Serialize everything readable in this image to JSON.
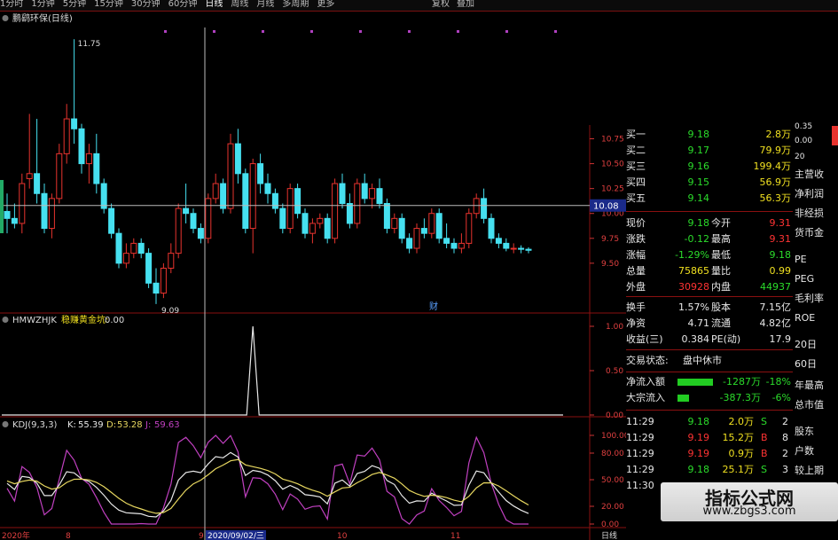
{
  "toolbar": {
    "periods": [
      "1分时",
      "1分钟",
      "5分钟",
      "15分钟",
      "30分钟",
      "60分钟",
      "日线",
      "周线",
      "月线",
      "多周期",
      "更多"
    ],
    "active_index": 6,
    "right_items": [
      "复权",
      "叠加"
    ]
  },
  "main_chart": {
    "title": "鹏鹞环保(日线)",
    "price_levels": [
      10.75,
      10.5,
      10.25,
      10.0,
      9.75,
      9.5
    ],
    "current_price_tag": "10.08",
    "high_label": "11.75",
    "low_label": "9.09",
    "event_marker": "财",
    "ohlc": [
      [
        10.02,
        10.2,
        9.8,
        9.95
      ],
      [
        9.95,
        10.1,
        9.85,
        9.9
      ],
      [
        9.9,
        10.4,
        9.8,
        10.3
      ],
      [
        10.35,
        11.0,
        10.25,
        10.4
      ],
      [
        10.4,
        10.95,
        10.1,
        10.2
      ],
      [
        10.2,
        10.3,
        9.8,
        9.85
      ],
      [
        9.85,
        10.2,
        9.75,
        10.15
      ],
      [
        10.15,
        10.7,
        10.1,
        10.6
      ],
      [
        10.6,
        11.1,
        10.5,
        10.95
      ],
      [
        10.95,
        11.75,
        10.7,
        10.85
      ],
      [
        10.85,
        10.9,
        10.4,
        10.5
      ],
      [
        10.5,
        10.7,
        10.3,
        10.6
      ],
      [
        10.6,
        10.8,
        10.2,
        10.3
      ],
      [
        10.3,
        10.35,
        10.0,
        10.05
      ],
      [
        10.05,
        10.1,
        9.75,
        9.8
      ],
      [
        9.8,
        9.85,
        9.45,
        9.5
      ],
      [
        9.5,
        9.7,
        9.45,
        9.6
      ],
      [
        9.6,
        9.75,
        9.55,
        9.7
      ],
      [
        9.7,
        9.75,
        9.55,
        9.6
      ],
      [
        9.6,
        9.65,
        9.25,
        9.3
      ],
      [
        9.3,
        9.45,
        9.09,
        9.2
      ],
      [
        9.2,
        9.5,
        9.15,
        9.45
      ],
      [
        9.45,
        9.7,
        9.4,
        9.6
      ],
      [
        9.6,
        10.1,
        9.55,
        10.05
      ],
      [
        10.05,
        10.3,
        9.9,
        10.0
      ],
      [
        10.0,
        10.05,
        9.8,
        9.85
      ],
      [
        9.85,
        9.9,
        9.7,
        9.75
      ],
      [
        9.75,
        10.2,
        9.7,
        10.15
      ],
      [
        10.15,
        10.4,
        10.1,
        10.3
      ],
      [
        10.3,
        10.35,
        10.0,
        10.05
      ],
      [
        10.05,
        10.8,
        10.0,
        10.7
      ],
      [
        10.7,
        10.85,
        10.3,
        10.4
      ],
      [
        10.4,
        10.45,
        9.8,
        9.85
      ],
      [
        9.85,
        10.55,
        9.6,
        10.5
      ],
      [
        10.5,
        10.6,
        10.2,
        10.3
      ],
      [
        10.3,
        10.4,
        10.1,
        10.2
      ],
      [
        10.2,
        10.25,
        10.0,
        10.05
      ],
      [
        10.05,
        10.1,
        9.8,
        9.85
      ],
      [
        9.85,
        10.3,
        9.8,
        10.25
      ],
      [
        10.25,
        10.3,
        9.95,
        10.0
      ],
      [
        10.0,
        10.05,
        9.75,
        9.8
      ],
      [
        9.8,
        9.95,
        9.7,
        9.9
      ],
      [
        9.9,
        10.0,
        9.85,
        9.95
      ],
      [
        9.95,
        10.0,
        9.7,
        9.75
      ],
      [
        9.75,
        10.35,
        9.7,
        10.3
      ],
      [
        10.3,
        10.4,
        10.05,
        10.1
      ],
      [
        10.1,
        10.2,
        9.85,
        9.9
      ],
      [
        9.9,
        10.35,
        9.85,
        10.3
      ],
      [
        10.3,
        10.4,
        10.1,
        10.15
      ],
      [
        10.15,
        10.3,
        10.05,
        10.25
      ],
      [
        10.25,
        10.35,
        10.05,
        10.1
      ],
      [
        10.1,
        10.15,
        9.8,
        9.85
      ],
      [
        9.85,
        10.0,
        9.8,
        9.95
      ],
      [
        9.95,
        10.0,
        9.7,
        9.75
      ],
      [
        9.75,
        9.8,
        9.6,
        9.65
      ],
      [
        9.65,
        9.9,
        9.6,
        9.85
      ],
      [
        9.85,
        9.95,
        9.75,
        9.8
      ],
      [
        9.8,
        10.05,
        9.75,
        10.0
      ],
      [
        10.0,
        10.05,
        9.7,
        9.75
      ],
      [
        9.75,
        9.9,
        9.65,
        9.7
      ],
      [
        9.7,
        9.75,
        9.6,
        9.65
      ],
      [
        9.65,
        9.8,
        9.6,
        9.7
      ],
      [
        9.7,
        10.05,
        9.65,
        10.0
      ],
      [
        10.0,
        10.2,
        9.95,
        10.15
      ],
      [
        10.15,
        10.25,
        9.9,
        9.95
      ],
      [
        9.95,
        10.0,
        9.7,
        9.75
      ],
      [
        9.75,
        9.8,
        9.65,
        9.7
      ],
      [
        9.7,
        9.75,
        9.62,
        9.65
      ],
      [
        9.65,
        9.7,
        9.6,
        9.65
      ],
      [
        9.65,
        9.68,
        9.6,
        9.64
      ],
      [
        9.64,
        9.66,
        9.6,
        9.63
      ]
    ]
  },
  "sub1": {
    "title": "HMWZHJK",
    "subtitle": "稳赚黄金坑:",
    "value": "0.00",
    "levels": [
      "1.00",
      "0.50",
      "0.00"
    ]
  },
  "kdj": {
    "title": "KDJ(9,3,3)",
    "k_label": "K:",
    "k_value": "55.39",
    "d_label": "D:",
    "d_value": "53.28",
    "j_label": "J:",
    "j_value": "59.63",
    "levels": [
      "100.00",
      "80.00",
      "50.00",
      "20.00",
      "0.00"
    ]
  },
  "x_axis": {
    "labels": [
      "2020年",
      "8",
      "9",
      "2020/09/02/三",
      "10",
      "11"
    ],
    "right_label": "日线"
  },
  "order_book": [
    {
      "label": "买一",
      "price": "9.18",
      "vol": "2.8万"
    },
    {
      "label": "买二",
      "price": "9.17",
      "vol": "79.9万"
    },
    {
      "label": "买三",
      "price": "9.16",
      "vol": "199.4万"
    },
    {
      "label": "买四",
      "price": "9.15",
      "vol": "56.9万"
    },
    {
      "label": "买五",
      "price": "9.14",
      "vol": "56.3万"
    }
  ],
  "quote": [
    {
      "l1": "现价",
      "v1": "9.18",
      "l2": "今开",
      "v2": "9.31"
    },
    {
      "l1": "涨跌",
      "v1": "-0.12",
      "l2": "最高",
      "v2": "9.31"
    },
    {
      "l1": "涨幅",
      "v1": "-1.29%",
      "l2": "最低",
      "v2": "9.18"
    },
    {
      "l1": "总量",
      "v1": "75865",
      "l2": "量比",
      "v2": "0.99"
    },
    {
      "l1": "外盘",
      "v1": "30928",
      "l2": "内盘",
      "v2": "44937"
    }
  ],
  "fundamentals": [
    {
      "l1": "换手",
      "v1": "1.57%",
      "l2": "股本",
      "v2": "7.15亿"
    },
    {
      "l1": "净资",
      "v1": "4.71",
      "l2": "流通",
      "v2": "4.82亿"
    },
    {
      "l1": "收益(三)",
      "v1": "0.384",
      "l2": "PE(动)",
      "v2": "17.9"
    }
  ],
  "trade_status": {
    "label": "交易状态:",
    "value": "盘中休市"
  },
  "flows": [
    {
      "label": "净流入额",
      "value": "-1287万",
      "pct": "-18%",
      "bar": 0.9
    },
    {
      "label": "大宗流入",
      "value": "-387.3万",
      "pct": "-6%",
      "bar": 0.3
    }
  ],
  "ticks": [
    {
      "time": "11:29",
      "price": "9.18",
      "vol": "2.0万",
      "side": "S",
      "n": "2"
    },
    {
      "time": "11:29",
      "price": "9.19",
      "vol": "15.2万",
      "side": "B",
      "n": "8"
    },
    {
      "time": "11:29",
      "price": "9.19",
      "vol": "0.9万",
      "side": "B",
      "n": "2"
    },
    {
      "time": "11:29",
      "price": "9.18",
      "vol": "25.1万",
      "side": "S",
      "n": "3"
    },
    {
      "time": "11:30",
      "price": "",
      "vol": "",
      "side": "",
      "n": ""
    }
  ],
  "far_right": {
    "top_values": [
      "0.35",
      "0.00"
    ],
    "top_label": "20",
    "items": [
      "主营收",
      "净利润",
      "非经损",
      "货币金",
      "PE",
      "PEG",
      "毛利率",
      "ROE",
      "20日",
      "60日",
      "年最高",
      "总市值",
      "股东",
      "户数",
      "较上期"
    ]
  },
  "watermark": {
    "title": "指标公式网",
    "url": "www.zbgs3.com"
  },
  "colors": {
    "up": "#e8332e",
    "down": "#46e0f0",
    "grid_red": "#8a1010",
    "k": "#e8e8e8",
    "d": "#e8d860",
    "j": "#c040c0"
  }
}
